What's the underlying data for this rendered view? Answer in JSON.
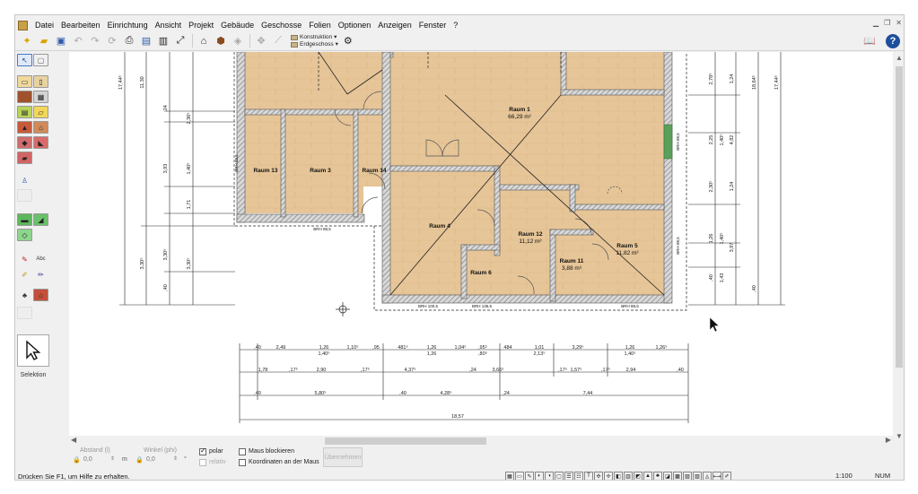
{
  "menu": {
    "items": [
      "Datei",
      "Bearbeiten",
      "Einrichtung",
      "Ansicht",
      "Projekt",
      "Gebäude",
      "Geschosse",
      "Folien",
      "Optionen",
      "Anzeigen",
      "Fenster",
      "?"
    ]
  },
  "toolbar": {
    "combo_top": "Konstruktion",
    "combo_bottom": "Erdgeschoss"
  },
  "rooms": {
    "r1": "Raum 1",
    "r1_area": "66,29 m²",
    "r13": "Raum 13",
    "r3": "Raum 3",
    "r14": "Raum 14",
    "r4": "Raum 4",
    "r12": "Raum 12",
    "r12_area": "11,12 m²",
    "r11": "Raum 11",
    "r11_area": "3,88 m²",
    "r5": "Raum 5",
    "r5_area": "11,82 m²",
    "r6": "Raum 6"
  },
  "window_labels": {
    "brh_a": "BRH 88,5",
    "brh_b": "BRH 100,5",
    "brh_c": "BRH 136,5",
    "brh_d": "BRH 88,5",
    "brh_left": "BRH 88,5",
    "brh_right_top": "BRH 88,5",
    "brh_right_bottom": "BRH 88,5"
  },
  "dimensions": {
    "left_outer_1": "17,44⁵",
    "left_outer_2": "11,30",
    "left_a": ",24",
    "left_b": "2,36⁵",
    "left_c": "3,93",
    "left_d": "1,40⁵",
    "left_e": "1,71",
    "left_f": "3,30⁵",
    "left_g": "3,30⁵",
    "left_h": "3,30⁵",
    "left_i": ",40",
    "right_a": "2,78⁵",
    "right_b": "1,24",
    "right_c": "18,64⁵",
    "right_d": "17,44⁵",
    "right_e": "2,25",
    "right_f": "1,40⁵",
    "right_g": "4,82",
    "right_h": "2,30⁵",
    "right_i": "1,24",
    "right_j": "1,26",
    "right_k": "1,40⁵",
    "right_l": "3,97",
    "right_m": ",40",
    "right_n": ",40",
    "right_o": "1,43",
    "right_p": ",40",
    "row1": [
      ",40",
      "2,49",
      "1,26",
      "1,10⁵",
      ",95",
      "481⁵",
      "1,26",
      "1,04⁵",
      ",95⁵",
      "484",
      "1,01",
      "3,29⁵",
      "1,26",
      "1,26⁵"
    ],
    "row1b": [
      "1,40⁵",
      "1,26",
      ",80⁵",
      "2,13⁵",
      "1,40⁵"
    ],
    "row2": [
      "1,78",
      ",17⁵",
      "2,90",
      ",17⁵",
      "4,37⁵",
      ",24",
      "3,66⁵",
      ",17⁵",
      "1,57⁵",
      ",17⁵",
      "2,94",
      ",40"
    ],
    "row3": [
      ",40",
      "5,80⁵",
      ",40",
      "4,28⁵",
      ",24",
      "7,44"
    ],
    "total": "18,57"
  },
  "palette": {
    "selection_label": "Selektion"
  },
  "coords": {
    "abstand_label": "Abstand (l)",
    "abstand_value": "0,0",
    "abstand_unit": "m",
    "winkel_label": "Winkel (phi)",
    "winkel_value": "0,0",
    "winkel_unit": "°",
    "polar_label": "polar",
    "relativ_label": "relativ",
    "maus_blockieren_label": "Maus blockieren",
    "koordinaten_label": "Koordinaten an der Maus",
    "apply_label": "Übernehmen"
  },
  "status": {
    "help_text": "Drücken Sie F1, um Hilfe zu erhalten.",
    "scale": "1:100",
    "num": "NUM"
  },
  "colors": {
    "floor": "#e6c598",
    "wall_hatch": "#8a8a8a",
    "window_green": "#5aa05a",
    "help_blue": "#1d4f9c"
  }
}
